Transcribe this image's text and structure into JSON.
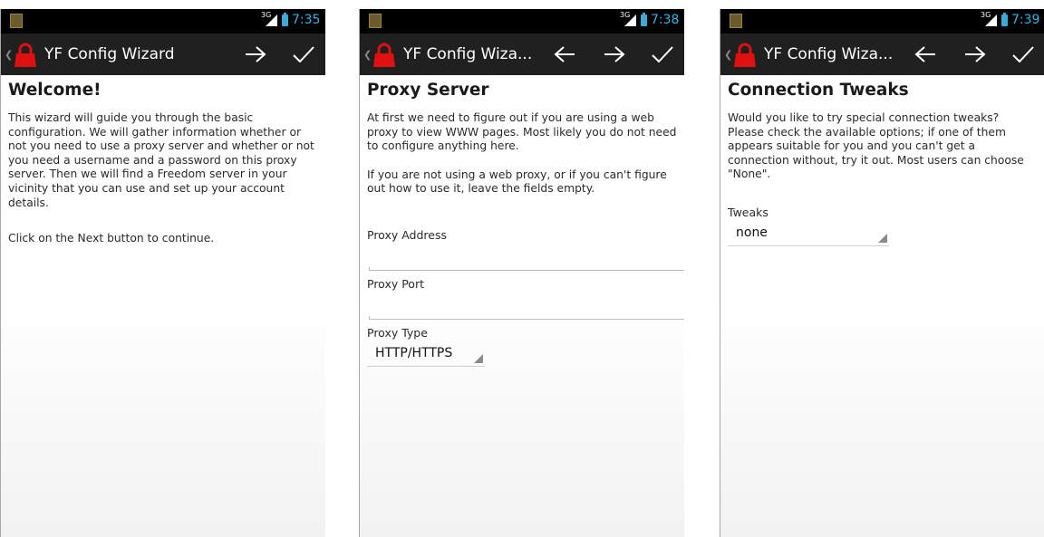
{
  "screens": [
    {
      "status": {
        "time": "7:35",
        "network": "3G"
      },
      "actionbar": {
        "title": "YF Config Wizard"
      },
      "title": "Welcome!",
      "paragraphs": [
        "This wizard will guide you through the basic configuration. We will gather information whether or not you need to use a proxy server and whether or not you need a username and a password on this proxy server. Then we will find a Freedom server in your vicinity that you can use and set up your account details.",
        "Click on the Next button to continue."
      ]
    },
    {
      "status": {
        "time": "7:38",
        "network": "3G"
      },
      "actionbar": {
        "title": "YF Config Wiza..."
      },
      "title": "Proxy Server",
      "paragraphs": [
        "At first we need to figure out if you are using a web proxy to view WWW pages. Most likely you do not need to configure anything here.",
        "If you are not using a web proxy, or if you can't figure out how to use it, leave the fields empty."
      ],
      "fields": {
        "proxy_address_label": "Proxy Address",
        "proxy_address_value": "",
        "proxy_port_label": "Proxy Port",
        "proxy_port_value": "",
        "proxy_type_label": "Proxy Type",
        "proxy_type_value": "HTTP/HTTPS"
      }
    },
    {
      "status": {
        "time": "7:39",
        "network": "3G"
      },
      "actionbar": {
        "title": "YF Config Wiza..."
      },
      "title": "Connection Tweaks",
      "paragraphs": [
        "Would you like to try special connection tweaks? Please check the available options; if one of them appears suitable for you and you can't get a connection without, try it out. Most users can choose \"None\"."
      ],
      "fields": {
        "tweaks_label": "Tweaks",
        "tweaks_value": "none"
      }
    }
  ],
  "icons": {
    "app": "red-padlock-icon",
    "back": "arrow-left-icon",
    "next": "arrow-right-icon",
    "done": "checkmark-icon"
  },
  "colors": {
    "status_bar": "#000000",
    "action_bar": "#202020",
    "clock": "#33b5e5",
    "app_icon": "#e01010"
  }
}
